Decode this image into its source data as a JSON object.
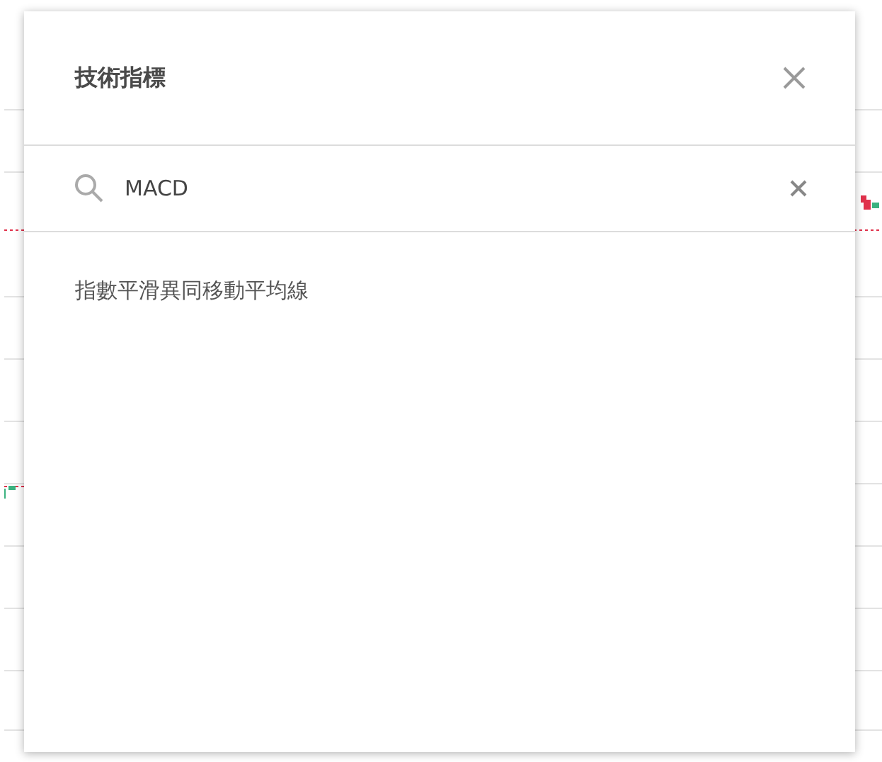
{
  "dialog": {
    "title": "技術指標"
  },
  "search": {
    "value": "MACD"
  },
  "results": [
    {
      "label": "指數平滑異同移動平均線"
    }
  ]
}
